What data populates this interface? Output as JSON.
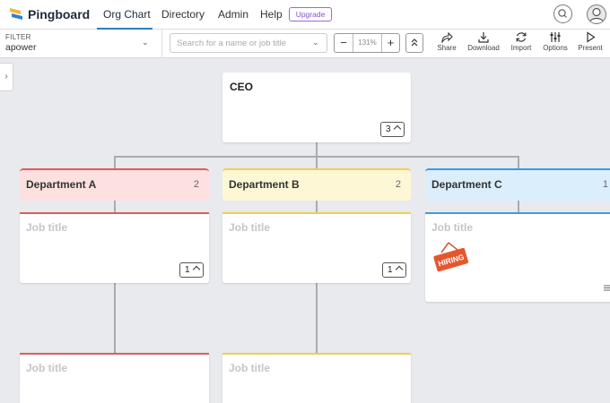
{
  "nav": {
    "brand": "Pingboard",
    "links": [
      "Org Chart",
      "Directory",
      "Admin",
      "Help"
    ],
    "upgrade": "Upgrade"
  },
  "toolbar": {
    "filter_label": "FILTER",
    "filter_value": "apower",
    "search_placeholder": "Search for a name or job title",
    "zoom": "131%",
    "tools": [
      "Share",
      "Download",
      "Import",
      "Options",
      "Present"
    ]
  },
  "chart": {
    "ceo": {
      "title": "CEO",
      "reports": "3"
    },
    "departments": [
      {
        "name": "Department A",
        "count": "2",
        "color": "#e15b5b",
        "bg": "#fde0e0"
      },
      {
        "name": "Department B",
        "count": "2",
        "color": "#f2cf49",
        "bg": "#fdf7d6"
      },
      {
        "name": "Department C",
        "count": "1",
        "color": "#3d9be0",
        "bg": "#dbeefc"
      }
    ],
    "jobs": [
      {
        "title": "Job title",
        "reports": "1"
      },
      {
        "title": "Job title",
        "reports": "1"
      },
      {
        "title": "Job title",
        "badge": "HIRING"
      },
      {
        "title": "Job title"
      },
      {
        "title": "Job title"
      }
    ]
  }
}
